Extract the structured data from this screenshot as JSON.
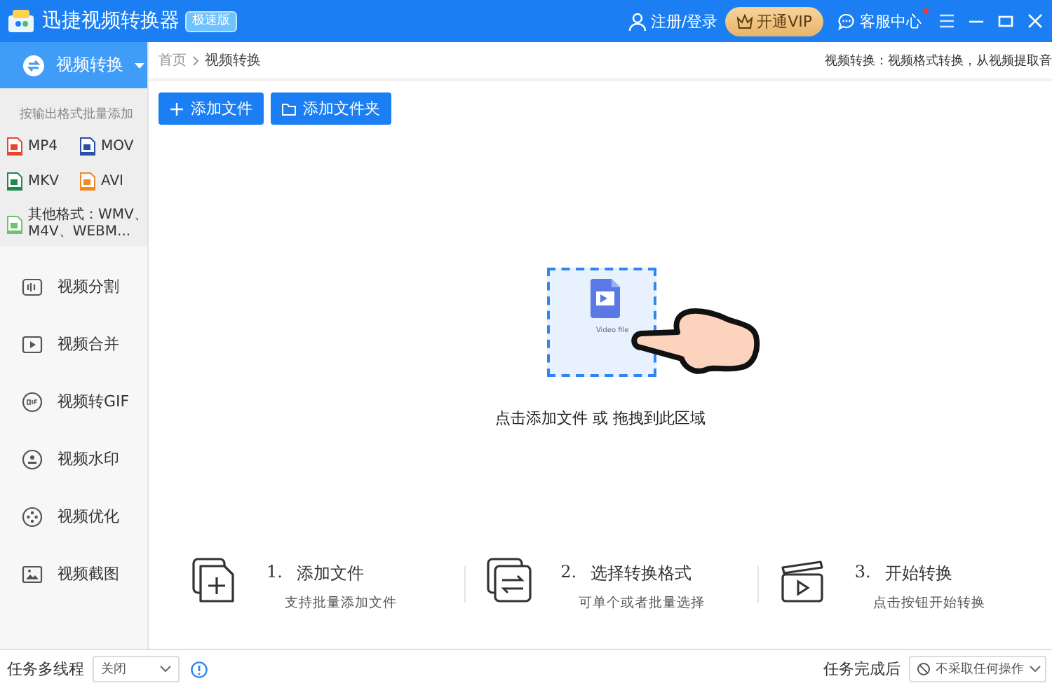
{
  "window": {
    "title": "迅捷视频转换器",
    "edition_badge": "极速版"
  },
  "titlebar": {
    "login": "注册/登录",
    "vip_button": "开通VIP",
    "support": "客服中心",
    "support_notification": true
  },
  "sidebar": {
    "header": "视频转换",
    "format_hint": "按输出格式批量添加",
    "formats": [
      {
        "label": "MP4",
        "color": "#e8462c"
      },
      {
        "label": "MOV",
        "color": "#2b4fa8"
      },
      {
        "label": "MKV",
        "color": "#1f8a4c"
      },
      {
        "label": "AVI",
        "color": "#f08a24"
      },
      {
        "label": "其他格式：WMV、M4V、WEBM...",
        "color": "#6cc36f"
      }
    ],
    "items": [
      "视频分割",
      "视频合并",
      "视频转GIF",
      "视频水印",
      "视频优化",
      "视频截图"
    ]
  },
  "main": {
    "breadcrumb": [
      "首页",
      "视频转换"
    ],
    "description": "视频转换：视频格式转换，从视频提取音",
    "buttons": [
      "添加文件",
      "添加文件夹"
    ],
    "drop_zone": {
      "file_caption": "Video file",
      "hint": "点击添加文件 或 拖拽到此区域"
    },
    "steps": [
      {
        "number": "1.",
        "title": "添加文件",
        "subtitle": "支持批量添加文件"
      },
      {
        "number": "2.",
        "title": "选择转换格式",
        "subtitle": "可单个或者批量选择"
      },
      {
        "number": "3.",
        "title": "开始转换",
        "subtitle": "点击按钮开始转换"
      }
    ]
  },
  "status_bar": {
    "multithread_label": "任务多线程",
    "multithread_value": "关闭",
    "after_label": "任务完成后",
    "after_value": "不采取任何操作"
  }
}
